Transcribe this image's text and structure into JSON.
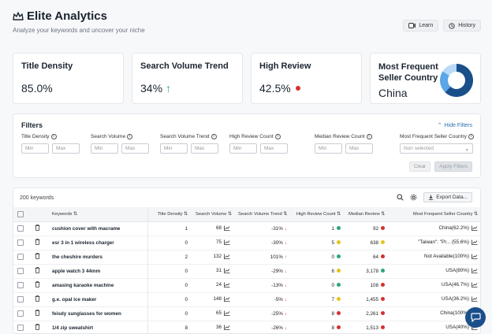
{
  "header": {
    "title": "Elite Analytics",
    "subtitle": "Analyze your keywords and uncover your niche",
    "learn_label": "Learn",
    "history_label": "History"
  },
  "cards": {
    "title_density": {
      "title": "Title Density",
      "value": "85.0%"
    },
    "search_trend": {
      "title": "Search Volume Trend",
      "value": "34%"
    },
    "high_review": {
      "title": "High Review",
      "value": "42.5%"
    },
    "seller_country": {
      "title": "Most Frequent Seller Country",
      "value": "China"
    }
  },
  "donut": {
    "segments": [
      {
        "value": 62.2,
        "color": "#1b4f8a"
      },
      {
        "value": 22,
        "color": "#5aa6e8"
      },
      {
        "value": 15.8,
        "color": "#b8daf7"
      }
    ]
  },
  "filters": {
    "title": "Filters",
    "hide_label": "Hide Filters",
    "labels": {
      "title_density": "Title Density",
      "search_volume": "Search Volume",
      "search_volume_trend": "Search Volume Trend",
      "high_review_count": "High Review Count",
      "median_review_count": "Median Review Count",
      "seller_country": "Most Frequent Seller Country"
    },
    "min_placeholder": "Min",
    "max_placeholder": "Max",
    "select_placeholder": "Non selected",
    "clear_label": "Clear",
    "apply_label": "Apply Filters"
  },
  "table": {
    "count_label": "200 keywords",
    "export_label": "Export Data...",
    "columns": [
      "Keywords",
      "Title Density",
      "Search Volume",
      "Search Volume Trend",
      "High Review Count",
      "Median Review",
      "Most Frequent Seller Country"
    ],
    "rows": [
      {
        "keyword": "cushion cover with macrame",
        "density": "1",
        "volume": "68",
        "trend": "-31%",
        "trend_dir": "down",
        "high": "1",
        "high_color": "#2aa876",
        "median": "92",
        "median_color": "#d6302f",
        "country": "China(62.2%)"
      },
      {
        "keyword": "esr 3 in 1 wireless charger",
        "density": "0",
        "volume": "75",
        "trend": "-30%",
        "trend_dir": "down",
        "high": "5",
        "high_color": "#e7c21c",
        "median": "638",
        "median_color": "#e7c21c",
        "country": "\"Taiwan\": \"Pr... (55.6%)"
      },
      {
        "keyword": "the cheshire murders",
        "density": "2",
        "volume": "132",
        "trend": "101%",
        "trend_dir": "up",
        "high": "0",
        "high_color": "#2aa876",
        "median": "64",
        "median_color": "#d6302f",
        "country": "Not Available(100%)"
      },
      {
        "keyword": "apple watch 3 44mm",
        "density": "0",
        "volume": "31",
        "trend": "-29%",
        "trend_dir": "down",
        "high": "6",
        "high_color": "#e7c21c",
        "median": "3,178",
        "median_color": "#2aa876",
        "country": "USA(80%)"
      },
      {
        "keyword": "amasing karaoke machine",
        "density": "0",
        "volume": "24",
        "trend": "-13%",
        "trend_dir": "down",
        "high": "0",
        "high_color": "#2aa876",
        "median": "108",
        "median_color": "#d6302f",
        "country": "USA(46.7%)"
      },
      {
        "keyword": "g.e. opal ice maker",
        "density": "0",
        "volume": "148",
        "trend": "-5%",
        "trend_dir": "down",
        "high": "7",
        "high_color": "#e7c21c",
        "median": "1,455",
        "median_color": "#d6302f",
        "country": "USA(36.2%)"
      },
      {
        "keyword": "feisdy sunglasses for women",
        "density": "0",
        "volume": "65",
        "trend": "-25%",
        "trend_dir": "down",
        "high": "8",
        "high_color": "#d6302f",
        "median": "2,261",
        "median_color": "#d6302f",
        "country": "China(100%)"
      },
      {
        "keyword": "1/4 zip sweatshirt",
        "density": "8",
        "volume": "36",
        "trend": "-26%",
        "trend_dir": "down",
        "high": "8",
        "high_color": "#d6302f",
        "median": "1,513",
        "median_color": "#d6302f",
        "country": "USA(40%)"
      }
    ]
  }
}
